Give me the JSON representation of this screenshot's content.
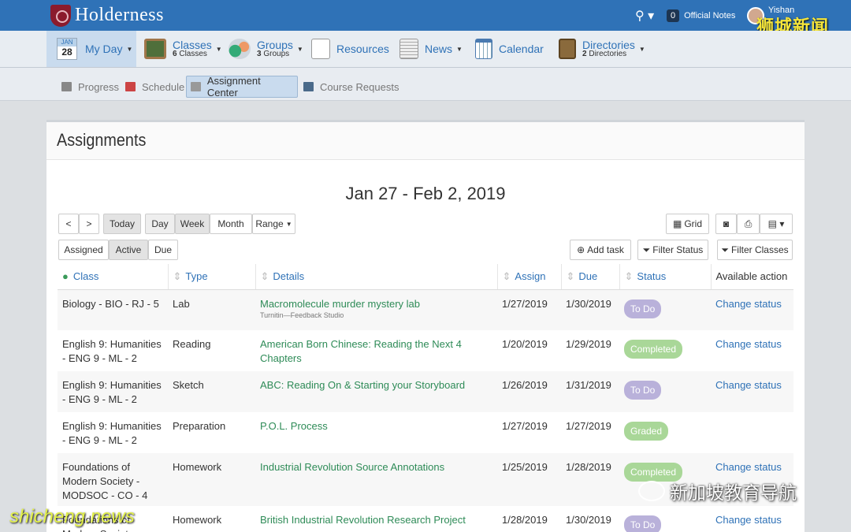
{
  "brand": {
    "name": "Holderness"
  },
  "topbar": {
    "notes_count": "0",
    "notes_label": "Official Notes",
    "user": "Yishan"
  },
  "watermark": {
    "top": "狮城新闻",
    "right": "新加坡教育导航",
    "left": "shicheng.news"
  },
  "nav": {
    "myday": {
      "month": "JAN",
      "day": "28",
      "label": "My Day"
    },
    "classes": {
      "label": "Classes",
      "count": "6",
      "suffix": "Classes"
    },
    "groups": {
      "label": "Groups",
      "count": "3",
      "suffix": "Groups"
    },
    "resources": "Resources",
    "news": "News",
    "calendar": "Calendar",
    "directories": {
      "label": "Directories",
      "count": "2",
      "suffix": "Directories"
    }
  },
  "subnav": {
    "progress": "Progress",
    "schedule": "Schedule",
    "assignment": "Assignment Center",
    "requests": "Course Requests"
  },
  "page": {
    "title": "Assignments",
    "range": "Jan 27 - Feb 2, 2019"
  },
  "toolbar": {
    "prev": "<",
    "next": ">",
    "today": "Today",
    "day": "Day",
    "week": "Week",
    "month": "Month",
    "range": "Range",
    "grid": "Grid",
    "assigned": "Assigned",
    "active": "Active",
    "due": "Due",
    "add": "Add task",
    "fstatus": "Filter Status",
    "fclasses": "Filter Classes"
  },
  "columns": [
    "Class",
    "Type",
    "Details",
    "Assign",
    "Due",
    "Status",
    "Available action"
  ],
  "rows": [
    {
      "class": "Biology - BIO - RJ - 5",
      "type": "Lab",
      "details": "Macromolecule murder mystery lab",
      "sub": "Turnitin—Feedback Studio",
      "assign": "1/27/2019",
      "due": "1/30/2019",
      "status": "To Do",
      "action": "Change status"
    },
    {
      "class": "English 9: Humanities - ENG 9 - ML - 2",
      "type": "Reading",
      "details": "American Born Chinese: Reading the Next 4 Chapters",
      "sub": "",
      "assign": "1/20/2019",
      "due": "1/29/2019",
      "status": "Completed",
      "action": "Change status"
    },
    {
      "class": "English 9: Humanities - ENG 9 - ML - 2",
      "type": "Sketch",
      "details": "ABC: Reading On & Starting your Storyboard",
      "sub": "",
      "assign": "1/26/2019",
      "due": "1/31/2019",
      "status": "To Do",
      "action": "Change status"
    },
    {
      "class": "English 9: Humanities - ENG 9 - ML - 2",
      "type": "Preparation",
      "details": "P.O.L. Process",
      "sub": "",
      "assign": "1/27/2019",
      "due": "1/27/2019",
      "status": "Graded",
      "action": ""
    },
    {
      "class": "Foundations of Modern Society - MODSOC - CO - 4",
      "type": "Homework",
      "details": "Industrial Revolution Source Annotations",
      "sub": "",
      "assign": "1/25/2019",
      "due": "1/28/2019",
      "status": "Completed",
      "action": "Change status"
    },
    {
      "class": "Foundations of Modern Society",
      "type": "Homework",
      "details": "British Industrial Revolution Research Project",
      "sub": "",
      "assign": "1/28/2019",
      "due": "1/30/2019",
      "status": "To Do",
      "action": "Change status"
    }
  ]
}
